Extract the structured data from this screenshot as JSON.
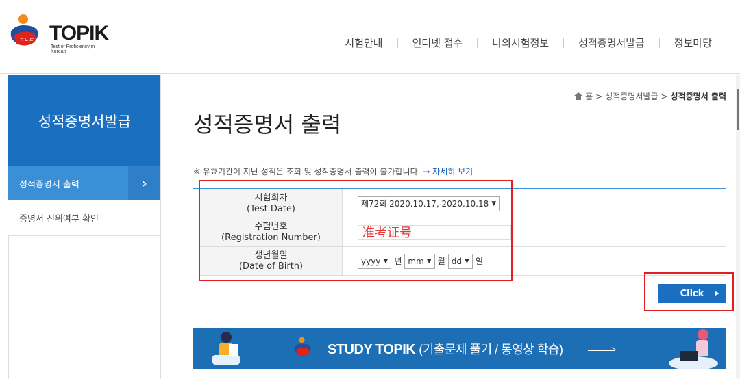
{
  "logo": {
    "name": "TOPIK",
    "tagline": "Test of Proficiency in Korean"
  },
  "nav": [
    "시험안내",
    "인터넷 접수",
    "나의시험정보",
    "성적증명서발급",
    "정보마당"
  ],
  "sidebar": {
    "title": "성적증명서발급",
    "items": [
      {
        "label": "성적증명서 출력",
        "active": true
      },
      {
        "label": "증명서 진위여부 확인",
        "active": false
      }
    ]
  },
  "breadcrumb": {
    "home": "홈",
    "sep": ">",
    "parent": "성적증명서발급",
    "current": "성적증명서 출력"
  },
  "page_title": "성적증명서 출력",
  "notice": {
    "text": "※ 유효기간이 지난 성적은 조회 및 성적증명서 출력이 불가합니다.",
    "link": "→ 자세히 보기"
  },
  "form": {
    "test_date": {
      "label": "시험회차",
      "label_en": "(Test Date)",
      "value": "제72회 2020.10.17, 2020.10.18"
    },
    "registration": {
      "label": "수험번호",
      "label_en": "(Registration Number)",
      "value": "准考证号"
    },
    "birth": {
      "label": "생년월일",
      "label_en": "(Date of Birth)",
      "year": "yyyy",
      "year_unit": "년",
      "month": "mm",
      "month_unit": "월",
      "day": "dd",
      "day_unit": "일"
    }
  },
  "submit_label": "Click",
  "banner": {
    "title": "STUDY TOPIK",
    "subtitle": "(기출문제 풀기 / 동영상 학습)"
  },
  "colors": {
    "primary": "#1a6fc0",
    "sidebar_active": "#3a8fd6",
    "highlight": "#e02020"
  }
}
